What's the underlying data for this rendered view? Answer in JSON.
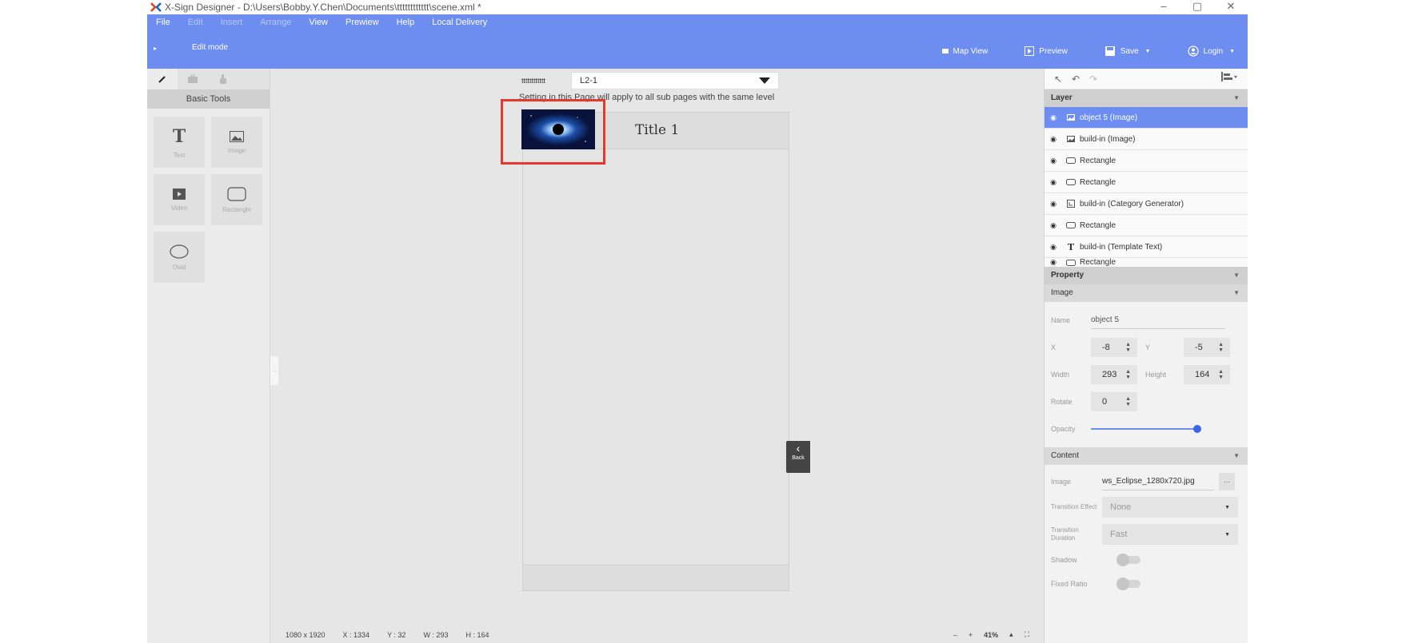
{
  "window": {
    "title": "X-Sign Designer - D:\\Users\\Bobby.Y.Chen\\Documents\\tttttttttttt\\scene.xml *",
    "minimize": "–",
    "restore": "▢",
    "close": "✕"
  },
  "menu": [
    {
      "label": "File",
      "enabled": true
    },
    {
      "label": "Edit",
      "enabled": false
    },
    {
      "label": "Insert",
      "enabled": false
    },
    {
      "label": "Arrange",
      "enabled": false
    },
    {
      "label": "View",
      "enabled": true
    },
    {
      "label": "Prewiew",
      "enabled": true
    },
    {
      "label": "Help",
      "enabled": true
    },
    {
      "label": "Local Delivery",
      "enabled": true
    }
  ],
  "toolbar": {
    "mode": "Edit mode",
    "map_view": "Map View",
    "preview": "Preview",
    "save": "Save",
    "login": "Login"
  },
  "tools": {
    "section": "Basic Tools",
    "items": [
      {
        "label": "Text",
        "icon": "text-icon"
      },
      {
        "label": "Image",
        "icon": "image-icon"
      },
      {
        "label": "Video",
        "icon": "video-icon"
      },
      {
        "label": "Rectangle",
        "icon": "rectangle-icon"
      },
      {
        "label": "Oval",
        "icon": "oval-icon"
      }
    ]
  },
  "canvas": {
    "page_prefix": "tttttttttttt",
    "page_select": "L2-1",
    "setting_note": "Setting in this Page will apply to all sub pages with the same level",
    "phone_title": "Title 1",
    "back_label": "Back"
  },
  "status": {
    "resolution": "1080 x 1920",
    "x": "X : 1334",
    "y": "Y : 32",
    "w": "W : 293",
    "h": "H : 164",
    "zoom_minus": "–",
    "zoom_plus": "+",
    "zoom": "41%"
  },
  "layers": {
    "title": "Layer",
    "items": [
      {
        "label": "object 5 (Image)",
        "icon": "image-icon",
        "selected": true
      },
      {
        "label": "build-in (Image)",
        "icon": "image-icon",
        "selected": false
      },
      {
        "label": "Rectangle",
        "icon": "rectangle-icon",
        "selected": false
      },
      {
        "label": "Rectangle",
        "icon": "rectangle-icon",
        "selected": false
      },
      {
        "label": "build-in (Category Generator)",
        "icon": "category-icon",
        "selected": false
      },
      {
        "label": "Rectangle",
        "icon": "rectangle-icon",
        "selected": false
      },
      {
        "label": "build-in (Template Text)",
        "icon": "text-icon",
        "selected": false
      },
      {
        "label": "Rectangle",
        "icon": "rectangle-icon",
        "selected": false
      }
    ]
  },
  "property": {
    "title": "Property",
    "image_section": "Image",
    "name_label": "Name",
    "name_value": "object 5",
    "x_label": "X",
    "x_value": "-8",
    "y_label": "Y",
    "y_value": "-5",
    "width_label": "Width",
    "width_value": "293",
    "height_label": "Height",
    "height_value": "164",
    "rotate_label": "Rotate",
    "rotate_value": "0",
    "opacity_label": "Opacity",
    "opacity_value": 1.0
  },
  "content": {
    "title": "Content",
    "image_label": "Image",
    "image_value": "ws_Eclipse_1280x720.jpg",
    "browse": "...",
    "transition_effect_label": "Transition Effect",
    "transition_effect_value": "None",
    "transition_duration_label": "Transition Duration",
    "transition_duration_value": "Fast",
    "shadow_label": "Shadow",
    "fixed_ratio_label": "Fixed Ratio"
  },
  "colors": {
    "accent": "#6d8df0",
    "highlight": "#e8372c"
  }
}
